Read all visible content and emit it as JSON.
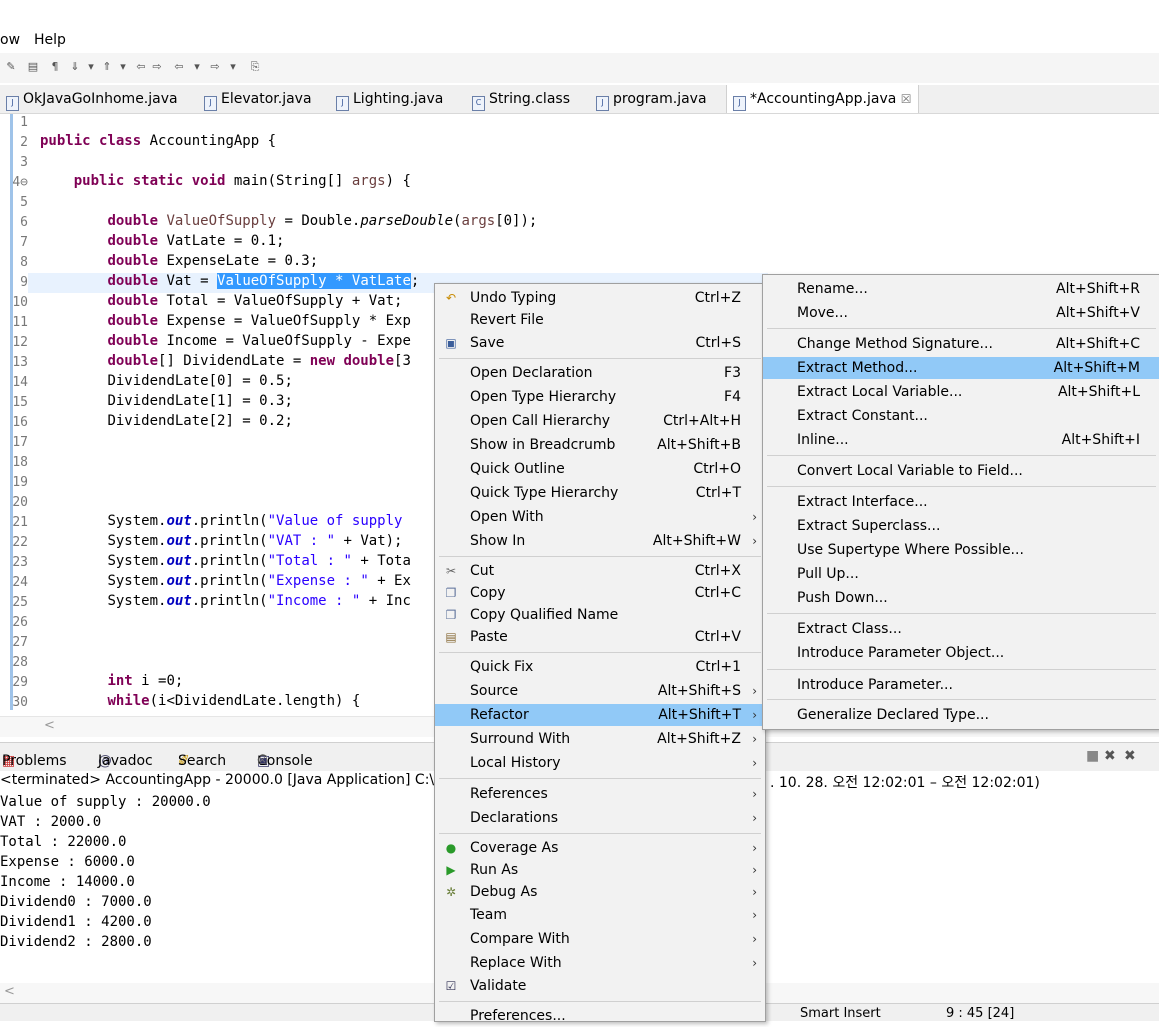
{
  "menubar": {
    "items": [
      "ow",
      "Help"
    ]
  },
  "editor_tabs": [
    {
      "label": "OkJavaGoInhome.java"
    },
    {
      "label": "Elevator.java"
    },
    {
      "label": "Lighting.java"
    },
    {
      "label": "String.class"
    },
    {
      "label": "program.java"
    },
    {
      "label": "*AccountingApp.java",
      "close": "☒"
    }
  ],
  "line_numbers": [
    "1",
    "2",
    "3",
    "4⊖",
    "5",
    "6",
    "7",
    "8",
    "9",
    "10",
    "11",
    "12",
    "13",
    "14",
    "15",
    "16",
    "17",
    "18",
    "19",
    "20",
    "21",
    "22",
    "23",
    "24",
    "25",
    "26",
    "27",
    "28",
    "29",
    "30"
  ],
  "code": {
    "l2": {
      "kw": "public class",
      "rest": " AccountingApp {"
    },
    "l4": {
      "kw": "public static void",
      "rest": " main(String[] ",
      "var": "args",
      "end": ") {"
    },
    "l6": {
      "kw": "double",
      "v": " ValueOfSupply",
      "a": " = Double.",
      "m": "parseDouble",
      "b": "(",
      "arg": "args",
      "c": "[0]);"
    },
    "l7": {
      "kw": "double",
      "rest": " VatLate = 0.1;"
    },
    "l8": {
      "kw": "double",
      "rest": " ExpenseLate = 0.3;"
    },
    "l9": {
      "kw": "double",
      "v": " Vat",
      "a": " = ",
      "sel": "ValueOfSupply * VatLate",
      "end": ";"
    },
    "l10": {
      "kw": "double",
      "rest": " Total = ValueOfSupply + Vat;"
    },
    "l11": {
      "kw": "double",
      "rest": " Expense = ValueOfSupply * Exp"
    },
    "l12": {
      "kw": "double",
      "rest": " Income = ValueOfSupply - Expe"
    },
    "l13": {
      "kw": "double",
      "rest": "[] DividendLate = ",
      "kw2": "new double",
      "end": "[3"
    },
    "l14": "DividendLate[0] = 0.5;",
    "l15": "DividendLate[1] = 0.3;",
    "l16": "DividendLate[2] = 0.2;",
    "l21": {
      "a": "System.",
      "f": "out",
      "b": ".println(",
      "s": "\"Value of supply"
    },
    "l22": {
      "a": "System.",
      "f": "out",
      "b": ".println(",
      "s": "\"VAT : \"",
      "c": " + Vat);"
    },
    "l23": {
      "a": "System.",
      "f": "out",
      "b": ".println(",
      "s": "\"Total : \"",
      "c": " + Tota"
    },
    "l24": {
      "a": "System.",
      "f": "out",
      "b": ".println(",
      "s": "\"Expense : \"",
      "c": " + Ex"
    },
    "l25": {
      "a": "System.",
      "f": "out",
      "b": ".println(",
      "s": "\"Income : \"",
      "c": " + Inc"
    },
    "l29": {
      "kw": "int",
      "rest": " i =0;"
    },
    "l30": {
      "kw": "while",
      "rest": "(i<DividendLate.length) {"
    }
  },
  "panel_tabs": [
    "Problems",
    "Javadoc",
    "Search",
    "Console",
    "☒"
  ],
  "console": {
    "header_left": "<terminated> AccountingApp - 20000.0 [Java Application] C:\\F",
    "header_right": ". 10. 28. 오전 12:02:01 – 오전 12:02:01)",
    "lines": [
      "Value of supply : 20000.0",
      "VAT : 2000.0",
      "Total : 22000.0",
      "Expense : 6000.0",
      "Income : 14000.0",
      "Dividend0 : 7000.0",
      "Dividend1 : 4200.0",
      "Dividend2 : 2800.0"
    ]
  },
  "statusbar": {
    "insert_mode": "Smart Insert",
    "position": "9 : 45 [24]"
  },
  "context_menu": {
    "items": [
      {
        "label": "Undo Typing",
        "accel": "Ctrl+Z",
        "icon": "undo-icon"
      },
      {
        "label": "Revert File",
        "accel": ""
      },
      {
        "label": "Save",
        "accel": "Ctrl+S",
        "icon": "save-icon"
      },
      {
        "label": "Open Declaration",
        "accel": "F3"
      },
      {
        "label": "Open Type Hierarchy",
        "accel": "F4"
      },
      {
        "label": "Open Call Hierarchy",
        "accel": "Ctrl+Alt+H"
      },
      {
        "label": "Show in Breadcrumb",
        "accel": "Alt+Shift+B"
      },
      {
        "label": "Quick Outline",
        "accel": "Ctrl+O"
      },
      {
        "label": "Quick Type Hierarchy",
        "accel": "Ctrl+T"
      },
      {
        "label": "Open With",
        "accel": "",
        "submenu": true
      },
      {
        "label": "Show In",
        "accel": "Alt+Shift+W",
        "submenu": true
      },
      {
        "label": "Cut",
        "accel": "Ctrl+X",
        "icon": "cut-icon"
      },
      {
        "label": "Copy",
        "accel": "Ctrl+C",
        "icon": "copy-icon"
      },
      {
        "label": "Copy Qualified Name",
        "accel": "",
        "icon": "copy-qualified-icon"
      },
      {
        "label": "Paste",
        "accel": "Ctrl+V",
        "icon": "paste-icon"
      },
      {
        "label": "Quick Fix",
        "accel": "Ctrl+1"
      },
      {
        "label": "Source",
        "accel": "Alt+Shift+S",
        "submenu": true
      },
      {
        "label": "Refactor",
        "accel": "Alt+Shift+T",
        "submenu": true,
        "highlighted": true
      },
      {
        "label": "Surround With",
        "accel": "Alt+Shift+Z",
        "submenu": true
      },
      {
        "label": "Local History",
        "accel": "",
        "submenu": true
      },
      {
        "label": "References",
        "accel": "",
        "submenu": true
      },
      {
        "label": "Declarations",
        "accel": "",
        "submenu": true
      },
      {
        "label": "Coverage As",
        "accel": "",
        "submenu": true,
        "icon": "coverage-icon"
      },
      {
        "label": "Run As",
        "accel": "",
        "submenu": true,
        "icon": "run-icon"
      },
      {
        "label": "Debug As",
        "accel": "",
        "submenu": true,
        "icon": "debug-icon"
      },
      {
        "label": "Team",
        "accel": "",
        "submenu": true
      },
      {
        "label": "Compare With",
        "accel": "",
        "submenu": true
      },
      {
        "label": "Replace With",
        "accel": "",
        "submenu": true
      },
      {
        "label": "Validate",
        "accel": "",
        "icon": "checkbox-icon"
      },
      {
        "label": "Preferences...",
        "accel": ""
      }
    ]
  },
  "refactor_menu": {
    "items": [
      {
        "label": "Rename...",
        "accel": "Alt+Shift+R"
      },
      {
        "label": "Move...",
        "accel": "Alt+Shift+V"
      },
      {
        "label": "Change Method Signature...",
        "accel": "Alt+Shift+C"
      },
      {
        "label": "Extract Method...",
        "accel": "Alt+Shift+M",
        "highlighted": true
      },
      {
        "label": "Extract Local Variable...",
        "accel": "Alt+Shift+L"
      },
      {
        "label": "Extract Constant...",
        "accel": ""
      },
      {
        "label": "Inline...",
        "accel": "Alt+Shift+I"
      },
      {
        "label": "Convert Local Variable to Field...",
        "accel": ""
      },
      {
        "label": "Extract Interface...",
        "accel": ""
      },
      {
        "label": "Extract Superclass...",
        "accel": ""
      },
      {
        "label": "Use Supertype Where Possible...",
        "accel": ""
      },
      {
        "label": "Pull Up...",
        "accel": ""
      },
      {
        "label": "Push Down...",
        "accel": ""
      },
      {
        "label": "Extract Class...",
        "accel": ""
      },
      {
        "label": "Introduce Parameter Object...",
        "accel": ""
      },
      {
        "label": "Introduce Parameter...",
        "accel": ""
      },
      {
        "label": "Generalize Declared Type...",
        "accel": ""
      }
    ]
  },
  "colors": {
    "highlight": "#91c9f7",
    "selection": "#3399ff",
    "keyword": "#7f0055",
    "string": "#2a00ff",
    "field": "#0000c0"
  }
}
